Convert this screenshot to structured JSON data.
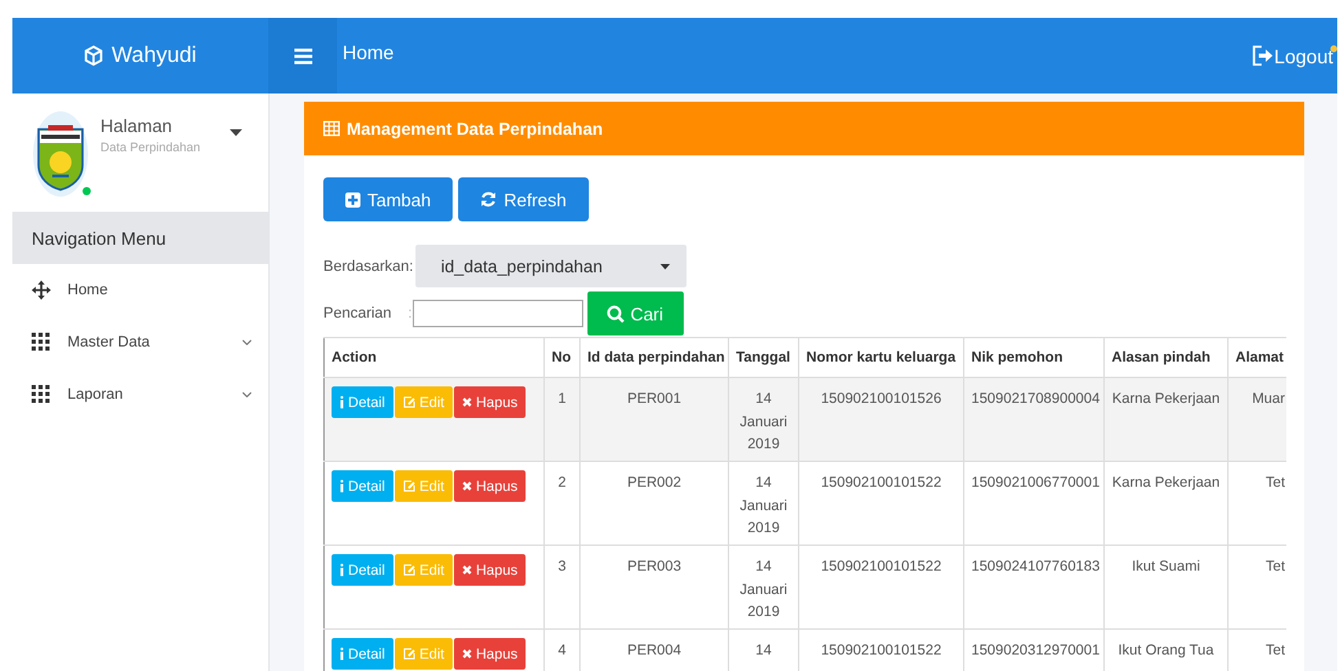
{
  "brand": {
    "name": "Wahyudi"
  },
  "topbar": {
    "title": "Home",
    "logout": "Logout"
  },
  "user_panel": {
    "title": "Halaman",
    "subtitle": "Data Perpindahan",
    "online": true
  },
  "sidebar": {
    "header": "Navigation Menu",
    "items": [
      {
        "label": "Home",
        "kind": "link",
        "expandable": false
      },
      {
        "label": "Master Data",
        "kind": "group",
        "expandable": true
      },
      {
        "label": "Laporan",
        "kind": "group",
        "expandable": true
      }
    ]
  },
  "panel": {
    "title": "Management Data Perpindahan",
    "buttons": [
      {
        "label": "Tambah",
        "kind": "add"
      },
      {
        "label": "Refresh",
        "kind": "refresh"
      }
    ],
    "filter": {
      "label": "Berdasarkan:",
      "value": "id_data_perpindahan"
    },
    "search": {
      "label": "Pencarian",
      "separator": ":",
      "button": "Cari"
    },
    "table": {
      "action_column": "Action",
      "columns": [
        "No",
        "Id data perpindahan",
        "Tanggal",
        "Nomor kartu keluarga",
        "Nik pemohon",
        "Alasan pindah",
        "Alamat"
      ],
      "rows": [
        {
          "highlighted": true,
          "actions": [
            {
              "kind": "detail",
              "label": "Detail"
            },
            {
              "kind": "edit",
              "label": "Edit"
            },
            {
              "kind": "delete",
              "label": "Hapus"
            }
          ],
          "cells": [
            "1",
            "PER001",
            "14 Januari 2019",
            "150902100101526",
            "1509021708900004",
            "Karna Pekerjaan",
            "Muar"
          ]
        },
        {
          "highlighted": false,
          "actions": [
            {
              "kind": "detail",
              "label": "Detail"
            },
            {
              "kind": "edit",
              "label": "Edit"
            },
            {
              "kind": "delete",
              "label": "Hapus"
            }
          ],
          "cells": [
            "2",
            "PER002",
            "14 Januari 2019",
            "150902100101522",
            "1509021006770001",
            "Karna Pekerjaan",
            "Tet"
          ]
        },
        {
          "highlighted": false,
          "actions": [
            {
              "kind": "detail",
              "label": "Detail"
            },
            {
              "kind": "edit",
              "label": "Edit"
            },
            {
              "kind": "delete",
              "label": "Hapus"
            }
          ],
          "cells": [
            "3",
            "PER003",
            "14 Januari 2019",
            "150902100101522",
            "1509024107760183",
            "Ikut Suami",
            "Tet"
          ]
        },
        {
          "highlighted": false,
          "actions": [
            {
              "kind": "detail",
              "label": "Detail"
            },
            {
              "kind": "edit",
              "label": "Edit"
            },
            {
              "kind": "delete",
              "label": "Hapus"
            }
          ],
          "cells": [
            "4",
            "PER004",
            "14",
            "150902100101522",
            "1509020312970001",
            "Ikut Orang Tua",
            "Tet"
          ]
        }
      ]
    }
  }
}
